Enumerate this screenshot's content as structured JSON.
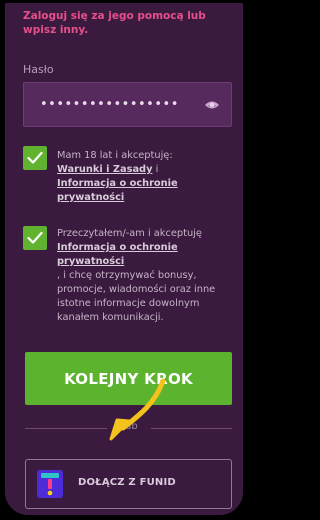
{
  "intro_text": "Zaloguj się za jego pomocą lub wpisz inny.",
  "password": {
    "label": "Hasło",
    "value": "•••••••••••••••••"
  },
  "checkbox_1": {
    "checked": true,
    "text": "Mam 18 lat i akceptuję:",
    "link_1": "Warunki i Zasady",
    "separator": " i ",
    "link_2": "Informacja o ochronie prywatności"
  },
  "checkbox_2": {
    "checked": true,
    "text": "Przeczytałem/-am i akceptuję",
    "link": "Informacja o ochronie prywatności",
    "suffix": ", i chcę otrzymywać bonusy, promocje, wiadomości oraz inne istotne informacje dowolnym kanałem komunikacji."
  },
  "next_button": {
    "label": "KOLEJNY KROK"
  },
  "divider": {
    "text": "lub"
  },
  "funid_button": {
    "label": "DOŁĄCZ Z FUNID"
  },
  "colors": {
    "background": "#3b1a3f",
    "accent_pink": "#e64f8a",
    "green": "#5cb32e",
    "arrow_yellow": "#f3c21d",
    "funid_purple": "#4d2bd6"
  },
  "icons": [
    "eye-icon",
    "checkmark-icon",
    "curved-arrow-icon",
    "funid-logo-icon"
  ]
}
